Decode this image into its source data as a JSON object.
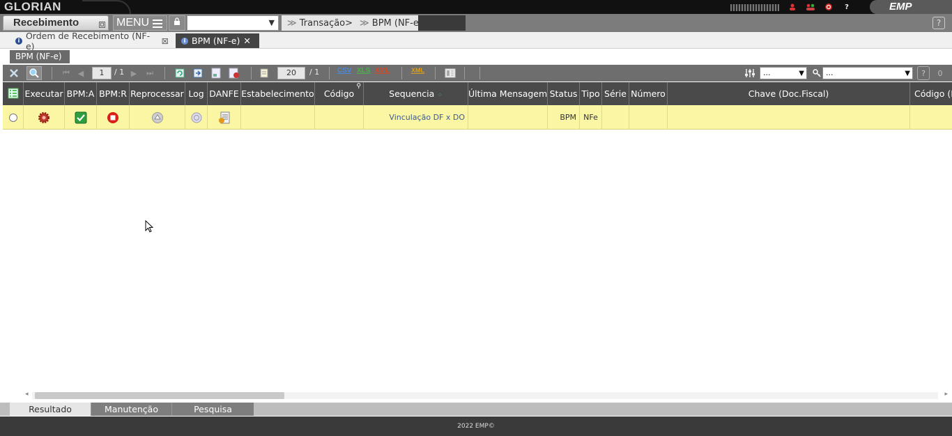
{
  "topbar": {
    "brand": "GLORIAN",
    "logo": "EMP",
    "icons": [
      "user-icon",
      "group-icon",
      "power-icon",
      "help-icon"
    ]
  },
  "module": {
    "title": "Recebimento",
    "menu_label": "MENU",
    "select_value": "",
    "breadcrumb": [
      "Transação>",
      "BPM (NF-e)>"
    ],
    "help": "?"
  },
  "tabs": [
    {
      "label": "Ordem de Recebimento (NF-e)",
      "close": "⊠",
      "active": false
    },
    {
      "label": "BPM (NF-e)",
      "close": "✕",
      "active": true
    }
  ],
  "subtab": "BPM (NF-e)",
  "toolbar": {
    "page_current": "1",
    "page_total": "/ 1",
    "rows_per_page": "20",
    "rows_total": "/ 1",
    "export_csv": "CSV",
    "export_xls": "XLS",
    "export_xml": "XML",
    "export_xml2": "XML",
    "filter1_value": "...",
    "filter2_value": "...",
    "counter": "0"
  },
  "grid": {
    "columns": [
      "Executar",
      "BPM:A",
      "BPM:R",
      "Reprocessar",
      "Log",
      "DANFE",
      "Estabelecimento",
      "Código",
      "Sequencia",
      "Última Mensagem",
      "Status",
      "Tipo",
      "Série",
      "Número",
      "Chave (Doc.Fiscal)",
      "Código (D"
    ],
    "rows": [
      {
        "estabelecimento": "",
        "codigo": "",
        "sequencia": "Vinculação DF x DO",
        "ultima_mensagem": "",
        "status": "BPM",
        "tipo": "NFe",
        "serie": "",
        "numero": "",
        "chave": "",
        "codigo_d": ""
      }
    ]
  },
  "bottom_tabs": [
    "Resultado",
    "Manutenção",
    "Pesquisa"
  ],
  "footer": "2022 EMP©",
  "colors": {
    "row_highlight": "#fbf6a4",
    "header_bg": "#4a4a4a",
    "link": "#3a5a9a"
  }
}
